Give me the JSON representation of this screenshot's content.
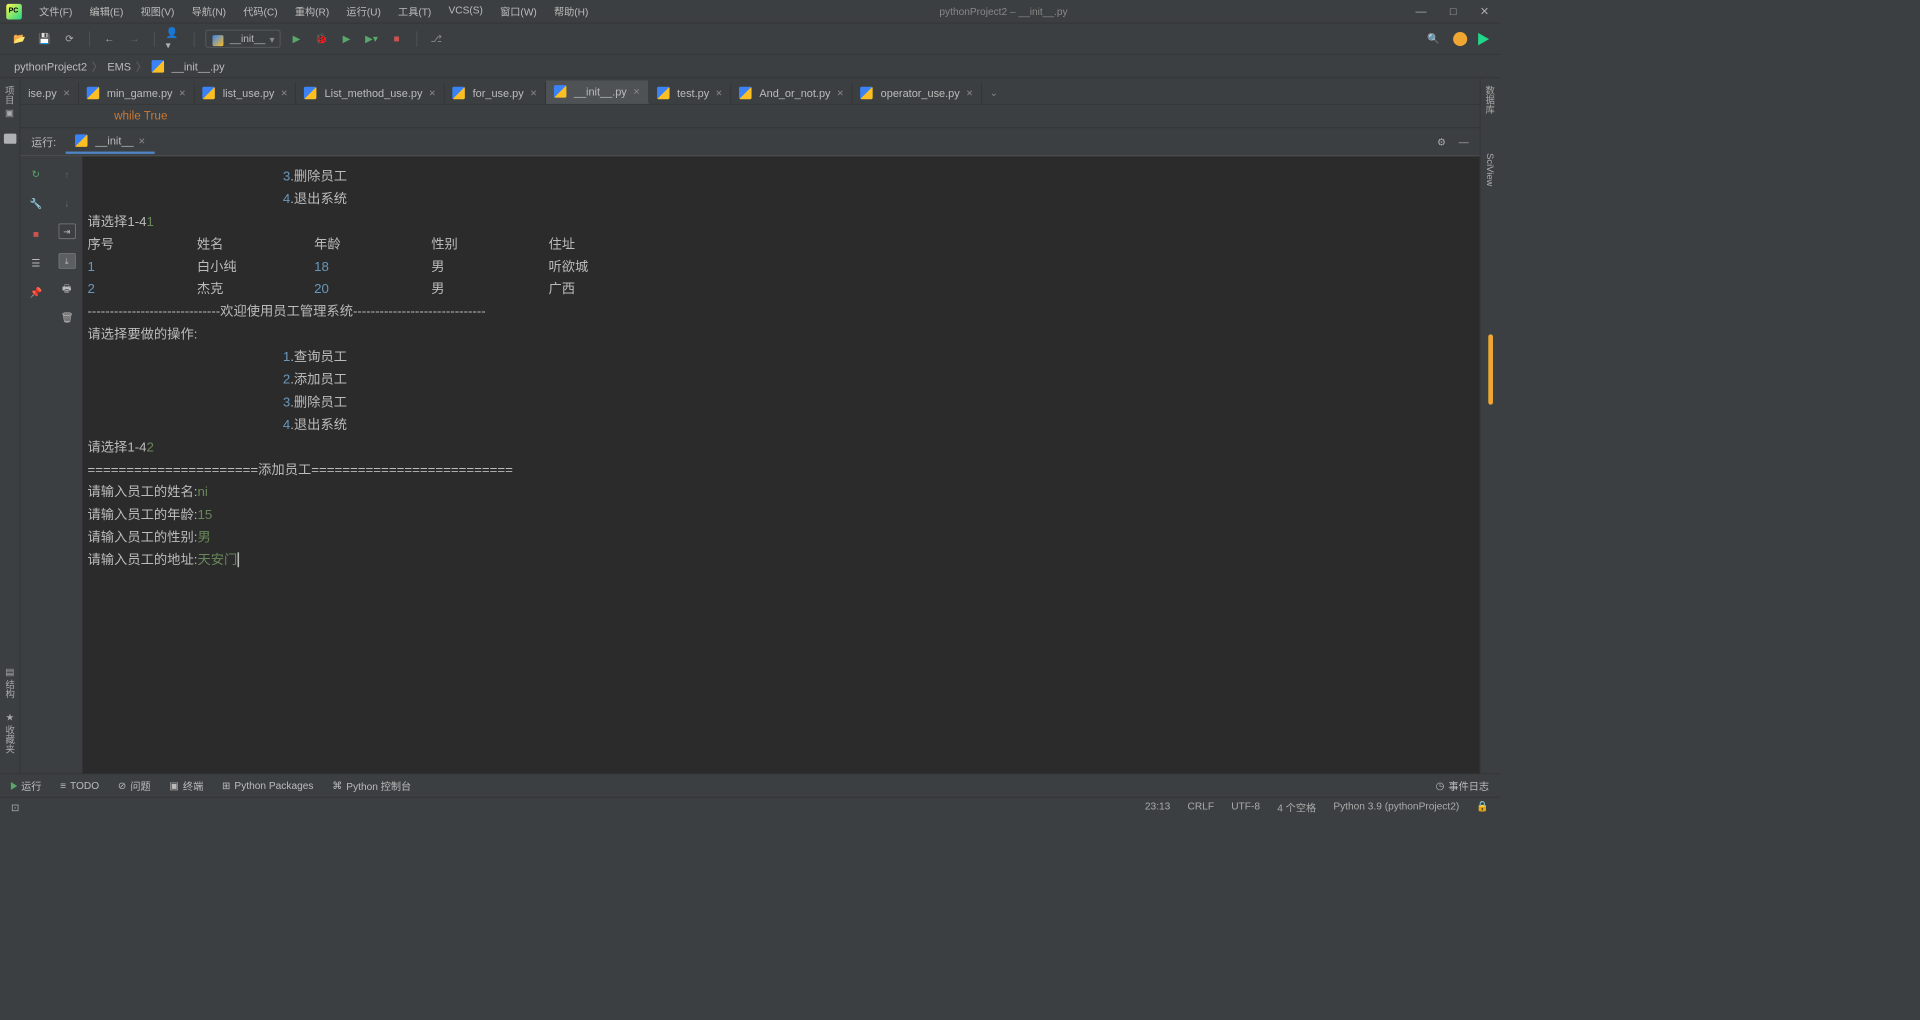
{
  "window": {
    "title": "pythonProject2 – __init__.py"
  },
  "menu": [
    "文件(F)",
    "编辑(E)",
    "视图(V)",
    "导航(N)",
    "代码(C)",
    "重构(R)",
    "运行(U)",
    "工具(T)",
    "VCS(S)",
    "窗口(W)",
    "帮助(H)"
  ],
  "run_config": "__init__",
  "breadcrumb": {
    "items": [
      "pythonProject2",
      "EMS",
      "__init__.py"
    ]
  },
  "left_sidebar": {
    "label": "项目"
  },
  "right_sidebar": {
    "top": "数据库",
    "sci": "SciView"
  },
  "tabs": [
    {
      "label": "ise.py",
      "active": false,
      "partial": true
    },
    {
      "label": "min_game.py",
      "active": false
    },
    {
      "label": "list_use.py",
      "active": false
    },
    {
      "label": "List_method_use.py",
      "active": false
    },
    {
      "label": "for_use.py",
      "active": false
    },
    {
      "label": "__init__.py",
      "active": true
    },
    {
      "label": "test.py",
      "active": false
    },
    {
      "label": "And_or_not.py",
      "active": false
    },
    {
      "label": "operator_use.py",
      "active": false
    }
  ],
  "context_line": "while True",
  "run_panel": {
    "label": "运行:",
    "tab": "__init__",
    "gear": "⚙",
    "min": "—"
  },
  "console": {
    "menu3": "3.删除员工",
    "menu4": "4.退出系统",
    "prompt1_pre": "请选择1-4",
    "prompt1_val": "1",
    "hdr": {
      "c1": "序号",
      "c2": "姓名",
      "c3": "年龄",
      "c4": "性别",
      "c5": "住址"
    },
    "r1": {
      "c1": "1",
      "c2": "白小纯",
      "c3": "18",
      "c4": "男",
      "c5": "听欲城"
    },
    "r2": {
      "c1": "2",
      "c2": "杰克",
      "c3": "20",
      "c4": "男",
      "c5": "广西"
    },
    "divider": "------------------------------欢迎使用员工管理系统------------------------------",
    "op_prompt": "请选择要做的操作:",
    "m1": "1.查询员工",
    "m2": "2.添加员工",
    "m3": "3.删除员工",
    "m4": "4.退出系统",
    "prompt2_pre": "请选择1-4",
    "prompt2_val": "2",
    "add_div": "======================添加员工==========================",
    "name_p": "请输入员工的姓名:",
    "name_v": "ni",
    "age_p": "请输入员工的年龄:",
    "age_v": "15",
    "sex_p": "请输入员工的性别:",
    "sex_v": "男",
    "addr_p": "请输入员工的地址:",
    "addr_v": "天安门"
  },
  "bottom": {
    "run": "运行",
    "todo": "TODO",
    "problems": "问题",
    "terminal": "终端",
    "pkg": "Python Packages",
    "pyconsole": "Python 控制台",
    "eventlog": "事件日志"
  },
  "left_bottom": {
    "struct": "结构",
    "fav": "收藏夹"
  },
  "status": {
    "pos": "23:13",
    "sep": "CRLF",
    "enc": "UTF-8",
    "indent": "4 个空格",
    "interp": "Python 3.9 (pythonProject2)"
  }
}
